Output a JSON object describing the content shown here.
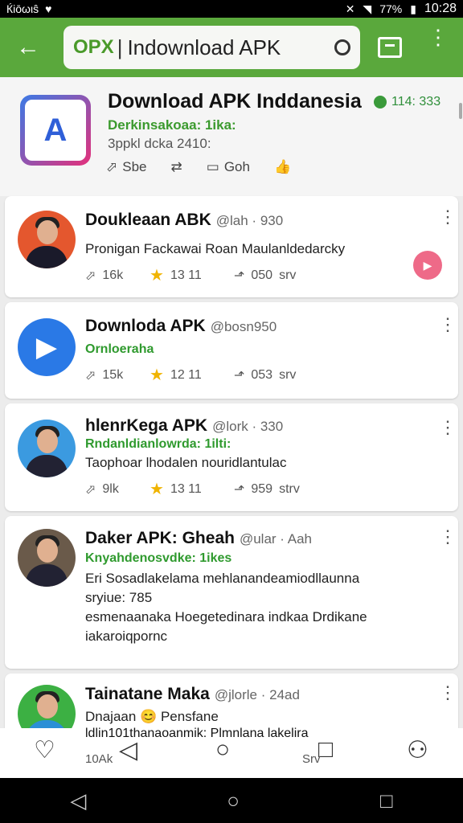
{
  "status_bar": {
    "carrier": "Ќiōωιŝ",
    "battery": "77%",
    "time": "10:28"
  },
  "app_bar": {
    "logo": "OPX",
    "separator": "|",
    "search_text": "Indownload APK"
  },
  "header": {
    "title": "Download APK Inddanesia",
    "badge": "114: 333",
    "subtitle": "Derkinsakoaa: 1ika:",
    "meta": "3ppkl dcka 2410:",
    "actions": {
      "share": "Sbe",
      "comment": "Goh"
    }
  },
  "posts": [
    {
      "name": "Doukleaan ABK",
      "handle": "@lah · 930",
      "green": "",
      "text": "Pronigan Fackawai Roan Maulanldedarcky",
      "stats": {
        "comments": "16k",
        "stars": "13 11",
        "shares": "050",
        "views": "srv"
      }
    },
    {
      "name": "Downloda APK",
      "handle": "@bosn950",
      "green": "Ornloeraha",
      "text": "",
      "stats": {
        "comments": "15k",
        "stars": "12 11",
        "shares": "053",
        "views": "srv"
      }
    },
    {
      "name": "hlenrKega APK",
      "handle": "@lork · 330",
      "green": "Rndanldianlowrda: 1ilti:",
      "text": "Taophoar lhodalen nouridlantulac",
      "stats": {
        "comments": "9lk",
        "stars": "13 11",
        "shares": "959",
        "views": "strv"
      }
    },
    {
      "name": "Daker APK: Gheah",
      "handle": "@ular · Aah",
      "green": "Knyahdenosvdke: 1ikes",
      "text": "Eri Sosadlakelama mehlanandeamiodllaunna",
      "text2": "sryiue: 785",
      "text3": "esmenaanaka Hoegetedinara indkaa Drdikane",
      "text4": "iakaroiqpornc",
      "stats": {}
    },
    {
      "name": "Tainatane Maka",
      "handle": "@jlorle · 24ad",
      "green": "",
      "text": "Dnajaan 😊 Pensfane",
      "text2": "ldlin101thanaoanmik: Plmnlana lakelira",
      "stats": {
        "comments": "10Ak",
        "views": "Srv"
      }
    }
  ],
  "icons": [
    "back-icon",
    "reload-icon",
    "tabs-icon",
    "menu-icon",
    "share-icon",
    "retweet-icon",
    "comment-icon",
    "like-icon",
    "star-icon",
    "more-icon",
    "play-icon",
    "home-icon",
    "back-nav-icon",
    "recent-nav-icon",
    "profile-icon"
  ],
  "colors": {
    "appbar": "#5aa83c",
    "green_text": "#2f9a2e",
    "star": "#f0b400",
    "play": "#ee6a88"
  }
}
